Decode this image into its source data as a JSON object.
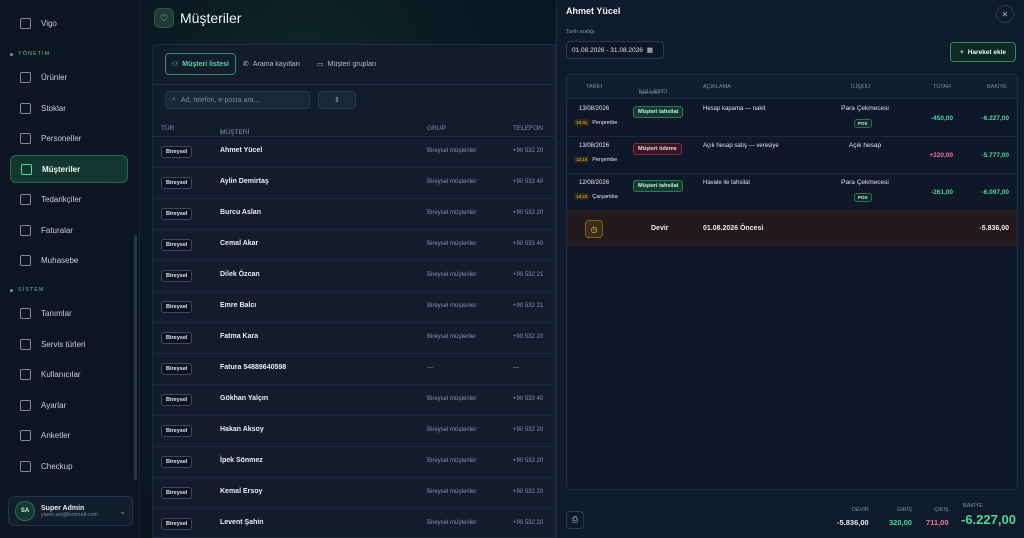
{
  "sidebar": {
    "top_item": "Vigo",
    "section_yonetim": "YÖNETİM",
    "items_yonetim": [
      "Ürünler",
      "Stoklar",
      "Personeller",
      "Müşteriler",
      "Tedarikçiler",
      "Faturalar",
      "Muhasebe"
    ],
    "section_sistem": "SİSTEM",
    "items_sistem": [
      "Tanımlar",
      "Servis türleri",
      "Kullanıcılar",
      "Ayarlar",
      "Anketler",
      "Checkup"
    ],
    "active_item": "Müşteriler",
    "user": {
      "initials": "SA",
      "name": "Super Admin",
      "email": "yasin.anl@hotmail.com"
    }
  },
  "page": {
    "title": "Müşteriler",
    "tabs": [
      "Müşteri listesi",
      "Arama kayıtları",
      "Müşteri grupları"
    ],
    "active_tab": "Müşteri listesi",
    "search_placeholder": "Ad, telefon, e-posta ara...",
    "columns": [
      "TÜR",
      "MÜŞTERİ",
      "GRUP",
      "TELEFON"
    ],
    "rows": [
      {
        "type": "Bireysel",
        "name": "Ahmet Yücel",
        "group": "Bireysel müşteriler",
        "phone": "+90 532 20"
      },
      {
        "type": "Bireysel",
        "name": "Aylin Demirtaş",
        "group": "Bireysel müşteriler",
        "phone": "+90 533 40"
      },
      {
        "type": "Bireysel",
        "name": "Burcu Aslan",
        "group": "Bireysel müşteriler",
        "phone": "+90 532 20"
      },
      {
        "type": "Bireysel",
        "name": "Cemal Akar",
        "group": "Bireysel müşteriler",
        "phone": "+90 533 40"
      },
      {
        "type": "Bireysel",
        "name": "Dilek Özcan",
        "group": "Bireysel müşteriler",
        "phone": "+90 532 21"
      },
      {
        "type": "Bireysel",
        "name": "Emre Balcı",
        "group": "Bireysel müşteriler",
        "phone": "+90 532 21"
      },
      {
        "type": "Bireysel",
        "name": "Fatma Kara",
        "group": "Bireysel müşteriler",
        "phone": "+90 532 20"
      },
      {
        "type": "Bireysel",
        "name": "Fatura 54889640598",
        "group": "—",
        "phone": "—"
      },
      {
        "type": "Bireysel",
        "name": "Gökhan Yalçın",
        "group": "Bireysel müşteriler",
        "phone": "+90 533 40"
      },
      {
        "type": "Bireysel",
        "name": "Hakan Aksoy",
        "group": "Bireysel müşteriler",
        "phone": "+90 532 20"
      },
      {
        "type": "Bireysel",
        "name": "İpek Sönmez",
        "group": "Bireysel müşteriler",
        "phone": "+90 532 20"
      },
      {
        "type": "Bireysel",
        "name": "Kemal Ersoy",
        "group": "Bireysel müşteriler",
        "phone": "+90 532 20"
      },
      {
        "type": "Bireysel",
        "name": "Levent Şahin",
        "group": "Bireysel müşteriler",
        "phone": "+90 532 20"
      }
    ]
  },
  "panel": {
    "title": "Ahmet Yücel",
    "date_label": "Tarih aralığı",
    "date_range": "01.08.2026 - 31.08.2026",
    "add_button": "Hareket ekle",
    "headers": {
      "date": "TARİH",
      "user": "KULLANICI",
      "user_sub": "İşlem türü",
      "desc": "AÇIKLAMA",
      "relation": "İLİŞKİLİ",
      "amount": "TUTAR",
      "balance": "BAKİYE"
    },
    "transactions": [
      {
        "date": "13/08/2026",
        "time": "16:31",
        "day": "Perşembe",
        "type": "Müşteri tahsilat",
        "type_color": "green",
        "desc": "Hesap kapama — nakit",
        "relation": "Para Çekmecesi",
        "tag": "POS",
        "amount": "-450,00",
        "amount_color": "green",
        "balance": "-6.227,00"
      },
      {
        "date": "13/08/2026",
        "time": "12:10",
        "day": "Perşembe",
        "type": "Müşteri ödeme",
        "type_color": "red",
        "desc": "Açık hesap satış — veresiye",
        "relation": "Açık hesap",
        "tag": "",
        "amount": "+320,00",
        "amount_color": "red",
        "balance": "-5.777,00"
      },
      {
        "date": "12/08/2026",
        "time": "16:23",
        "day": "Çarşamba",
        "type": "Müşteri tahsilat",
        "type_color": "green",
        "desc": "Havale ile tahsilat",
        "relation": "Para Çekmecesi",
        "tag": "POS",
        "amount": "-261,00",
        "amount_color": "green",
        "balance": "-6.097,00"
      }
    ],
    "carryover": {
      "label": "Devir",
      "date": "01.08.2026 Öncesi",
      "balance": "-5.836,00"
    },
    "summary": {
      "devir_label": "DEVİR",
      "devir_value": "-5.836,00",
      "giris_label": "GİRİŞ",
      "giris_value": "320,00",
      "cikis_label": "ÇIKIŞ",
      "cikis_value": "711,00",
      "bakiye_label": "BAKİYE",
      "bakiye_value": "-6.227,00"
    }
  },
  "colors": {
    "accent": "#58d6a2",
    "positive": "#4fd69a",
    "negative": "#f07a9a"
  }
}
